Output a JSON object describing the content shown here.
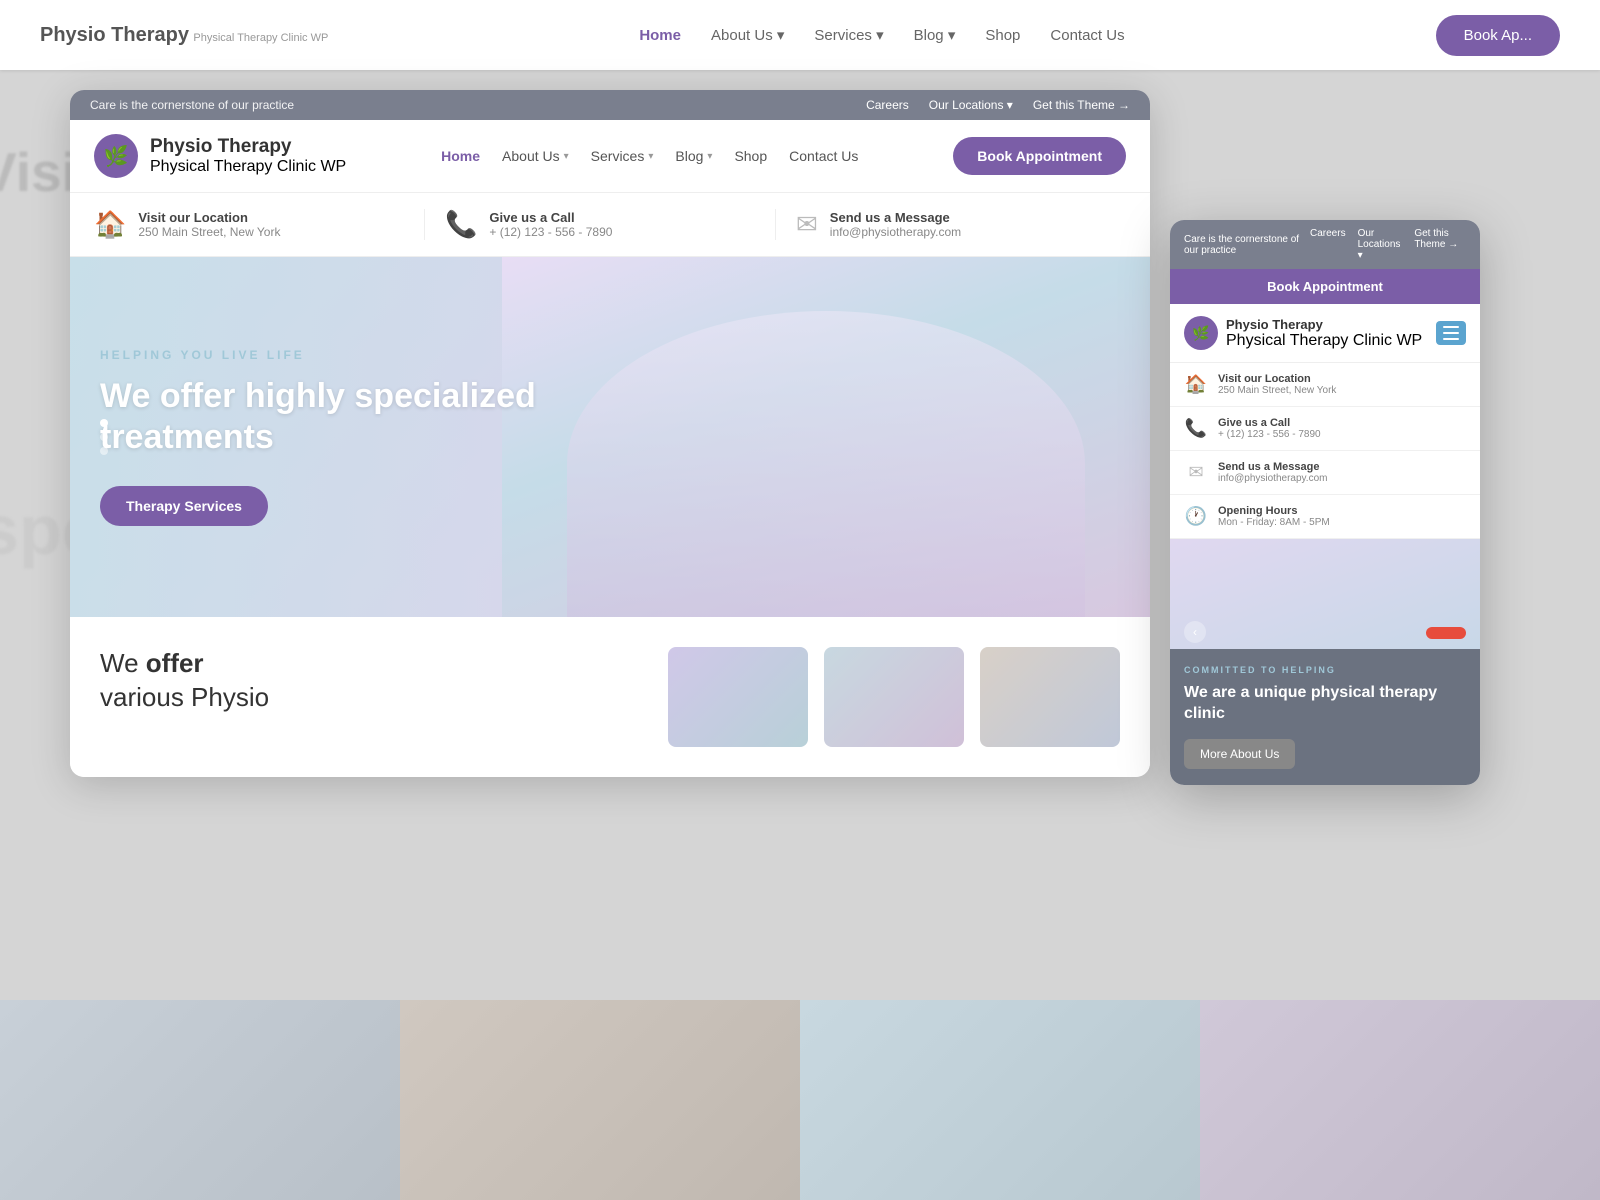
{
  "site": {
    "name": "Physio Therapy",
    "tagline": "Physical Therapy Clinic WP",
    "logo_symbol": "🌿"
  },
  "top_bar": {
    "message": "Care is the cornerstone of our practice",
    "links": [
      "Careers",
      "Our Locations ▾",
      "Get this Theme →"
    ]
  },
  "nav": {
    "links": [
      "Home",
      "About Us ▾",
      "Services ▾",
      "Blog ▾",
      "Shop",
      "Contact Us"
    ],
    "active": "Home",
    "book_btn": "Book Appointment"
  },
  "info_bar": {
    "items": [
      {
        "icon": "🏠",
        "title": "Visit our Location",
        "sub": "250 Main Street, New York"
      },
      {
        "icon": "📞",
        "title": "Give us a Call",
        "sub": "+ (12) 123 - 556 - 7890"
      },
      {
        "icon": "✉",
        "title": "Send us a Message",
        "sub": "info@physiotherapy.com"
      }
    ]
  },
  "hero": {
    "tagline": "HELPING YOU LIVE LIFE",
    "title": "We offer highly specialized treatments",
    "cta": "Therapy Services"
  },
  "below_hero": {
    "offer_title_plain": "We",
    "offer_title_bold": "offer",
    "offer_line2_plain": "various Physio"
  },
  "mobile": {
    "top_bar": {
      "message": "Care is the cornerstone of our practice",
      "links": [
        "Careers",
        "Our Locations ▾",
        "Get this Theme →"
      ]
    },
    "book_btn": "Book Appointment",
    "info_items": [
      {
        "icon": "🏠",
        "title": "Visit our Location",
        "sub": "250 Main Street, New York"
      },
      {
        "icon": "📞",
        "title": "Give us a Call",
        "sub": "+ (12) 123 - 556 - 7890"
      },
      {
        "icon": "✉",
        "title": "Send us a Message",
        "sub": "info@physiotherapy.com"
      },
      {
        "icon": "🕐",
        "title": "Opening Hours",
        "sub": "Mon - Friday: 8AM - 5PM"
      }
    ],
    "committed_label": "COMMITTED TO HELPING",
    "bottom_title": "We are a unique physical therapy clinic",
    "more_btn": "More About Us"
  },
  "bg": {
    "text_left_top": "Visit our",
    "text_left_mid": "specia",
    "text_bottom": "offer",
    "book_btn_bg": "Book Ap"
  }
}
